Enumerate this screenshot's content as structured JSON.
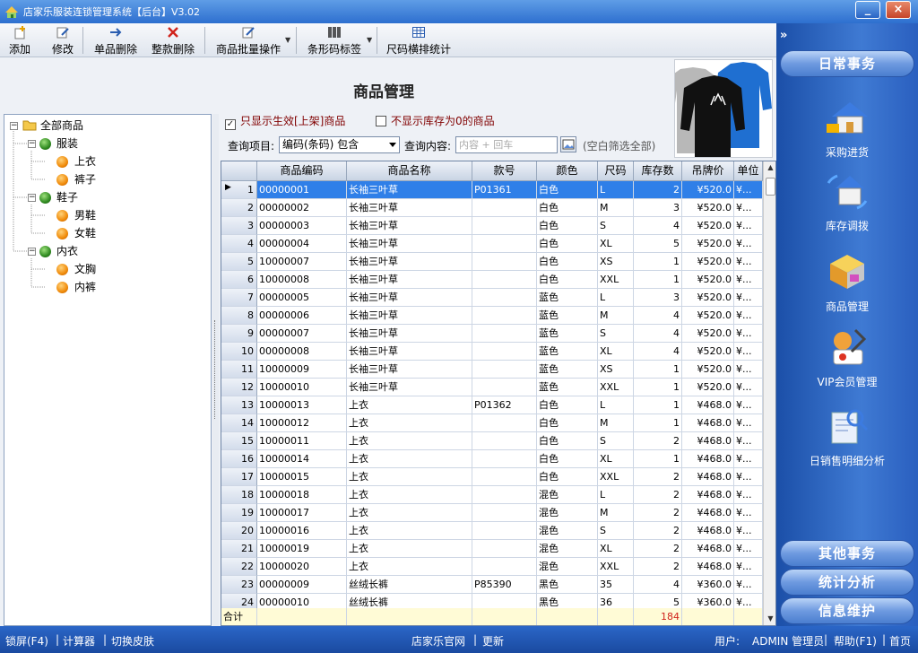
{
  "window": {
    "title": "店家乐服装连锁管理系统【后台】V3.02",
    "minimize": "_",
    "close": "×"
  },
  "toolbar": {
    "add": "添加",
    "edit": "修改",
    "delete_item": "单品删除",
    "delete_style": "整款删除",
    "batch_ops": "商品批量操作",
    "barcode_label": "条形码标签",
    "size_stats": "尺码横排统计"
  },
  "page_title": "商品管理",
  "filters": {
    "only_active": "只显示生效[上架]商品",
    "only_active_checked": true,
    "hide_zero_stock": "不显示库存为0的商品",
    "hide_zero_stock_checked": false,
    "query_item_label": "查询项目:",
    "query_item_value": "编码(条码) 包含",
    "query_content_label": "查询内容:",
    "query_placeholder": "内容 + 回车",
    "hint": "(空白筛选全部)"
  },
  "tree": {
    "root": "全部商品",
    "groups": [
      {
        "label": "服装",
        "children": [
          "上衣",
          "裤子"
        ]
      },
      {
        "label": "鞋子",
        "children": [
          "男鞋",
          "女鞋"
        ]
      },
      {
        "label": "内衣",
        "children": [
          "文胸",
          "内裤"
        ]
      }
    ]
  },
  "grid": {
    "columns": [
      "商品编码",
      "商品名称",
      "款号",
      "颜色",
      "尺码",
      "库存数",
      "吊牌价",
      "单位"
    ],
    "rows": [
      [
        "1",
        "00000001",
        "长袖三叶草",
        "P01361",
        "白色",
        "L",
        "2",
        "¥520.0",
        "¥..."
      ],
      [
        "2",
        "00000002",
        "长袖三叶草",
        "",
        "白色",
        "M",
        "3",
        "¥520.0",
        "¥..."
      ],
      [
        "3",
        "00000003",
        "长袖三叶草",
        "",
        "白色",
        "S",
        "4",
        "¥520.0",
        "¥..."
      ],
      [
        "4",
        "00000004",
        "长袖三叶草",
        "",
        "白色",
        "XL",
        "5",
        "¥520.0",
        "¥..."
      ],
      [
        "5",
        "10000007",
        "长袖三叶草",
        "",
        "白色",
        "XS",
        "1",
        "¥520.0",
        "¥..."
      ],
      [
        "6",
        "10000008",
        "长袖三叶草",
        "",
        "白色",
        "XXL",
        "1",
        "¥520.0",
        "¥..."
      ],
      [
        "7",
        "00000005",
        "长袖三叶草",
        "",
        "蓝色",
        "L",
        "3",
        "¥520.0",
        "¥..."
      ],
      [
        "8",
        "00000006",
        "长袖三叶草",
        "",
        "蓝色",
        "M",
        "4",
        "¥520.0",
        "¥..."
      ],
      [
        "9",
        "00000007",
        "长袖三叶草",
        "",
        "蓝色",
        "S",
        "4",
        "¥520.0",
        "¥..."
      ],
      [
        "10",
        "00000008",
        "长袖三叶草",
        "",
        "蓝色",
        "XL",
        "4",
        "¥520.0",
        "¥..."
      ],
      [
        "11",
        "10000009",
        "长袖三叶草",
        "",
        "蓝色",
        "XS",
        "1",
        "¥520.0",
        "¥..."
      ],
      [
        "12",
        "10000010",
        "长袖三叶草",
        "",
        "蓝色",
        "XXL",
        "1",
        "¥520.0",
        "¥..."
      ],
      [
        "13",
        "10000013",
        "上衣",
        "P01362",
        "白色",
        "L",
        "1",
        "¥468.0",
        "¥..."
      ],
      [
        "14",
        "10000012",
        "上衣",
        "",
        "白色",
        "M",
        "1",
        "¥468.0",
        "¥..."
      ],
      [
        "15",
        "10000011",
        "上衣",
        "",
        "白色",
        "S",
        "2",
        "¥468.0",
        "¥..."
      ],
      [
        "16",
        "10000014",
        "上衣",
        "",
        "白色",
        "XL",
        "1",
        "¥468.0",
        "¥..."
      ],
      [
        "17",
        "10000015",
        "上衣",
        "",
        "白色",
        "XXL",
        "2",
        "¥468.0",
        "¥..."
      ],
      [
        "18",
        "10000018",
        "上衣",
        "",
        "混色",
        "L",
        "2",
        "¥468.0",
        "¥..."
      ],
      [
        "19",
        "10000017",
        "上衣",
        "",
        "混色",
        "M",
        "2",
        "¥468.0",
        "¥..."
      ],
      [
        "20",
        "10000016",
        "上衣",
        "",
        "混色",
        "S",
        "2",
        "¥468.0",
        "¥..."
      ],
      [
        "21",
        "10000019",
        "上衣",
        "",
        "混色",
        "XL",
        "2",
        "¥468.0",
        "¥..."
      ],
      [
        "22",
        "10000020",
        "上衣",
        "",
        "混色",
        "XXL",
        "2",
        "¥468.0",
        "¥..."
      ],
      [
        "23",
        "00000009",
        "丝绒长裤",
        "P85390",
        "黑色",
        "35",
        "4",
        "¥360.0",
        "¥..."
      ],
      [
        "24",
        "00000010",
        "丝绒长裤",
        "",
        "黑色",
        "36",
        "5",
        "¥360.0",
        "¥..."
      ]
    ],
    "total_label": "合计",
    "total_stock": "184"
  },
  "right_panel": {
    "collapse": "»",
    "daily": "日常事务",
    "items": [
      "采购进货",
      "库存调拨",
      "商品管理",
      "VIP会员管理",
      "日销售明细分析"
    ],
    "other": "其他事务",
    "stats": "统计分析",
    "info": "信息维护"
  },
  "statusbar": {
    "lock": "锁屏(F4)",
    "calc": "计算器",
    "skin": "切换皮肤",
    "site": "店家乐官网",
    "update": "更新",
    "user_label": "用户:",
    "user": "ADMIN 管理员",
    "help": "帮助(F1)",
    "home": "首页"
  }
}
